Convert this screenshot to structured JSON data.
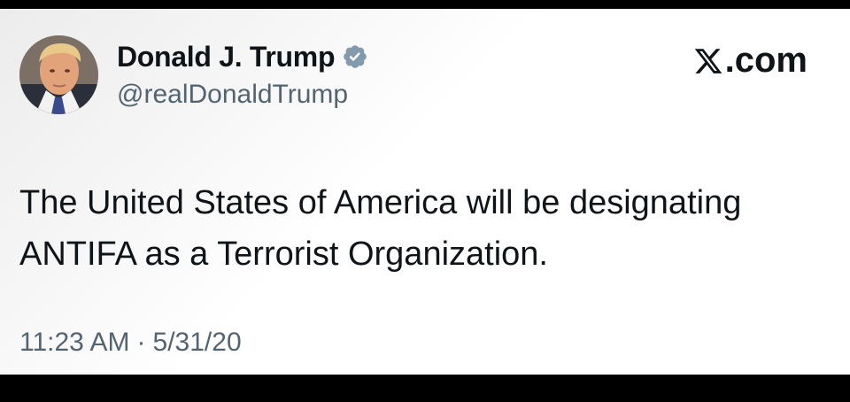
{
  "author": {
    "display_name": "Donald J. Trump",
    "handle": "@realDonaldTrump",
    "verified": true
  },
  "brand": {
    "label": ".com",
    "icon": "x-logo-icon"
  },
  "tweet": {
    "line1": "The United States of America will be designating",
    "line2": "ANTIFA as a Terrorist Organization.",
    "time": "11:23 AM",
    "separator": "·",
    "date": "5/31/20"
  },
  "colors": {
    "text_primary": "#0f1419",
    "text_secondary": "#536471",
    "verified_badge": "#829aab"
  }
}
